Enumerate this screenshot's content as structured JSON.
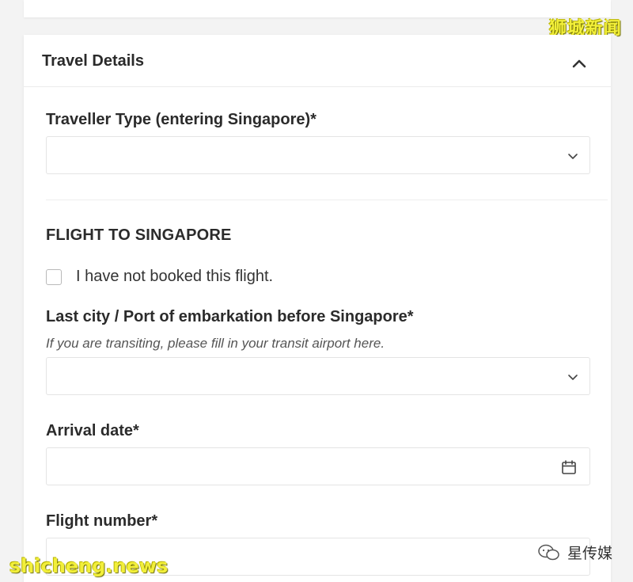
{
  "watermarks": {
    "top_right": "狮城新闻",
    "bottom_left": "shicheng.news",
    "bottom_right": "星传媒"
  },
  "section": {
    "title": "Travel Details",
    "collapse_icon": "chevron-up-icon"
  },
  "traveller_type": {
    "label": "Traveller Type (entering Singapore)*",
    "value": "",
    "icon": "chevron-down-icon"
  },
  "flight": {
    "heading": "FLIGHT TO SINGAPORE",
    "not_booked_label": "I have not booked this flight.",
    "not_booked_checked": false,
    "last_city_label": "Last city / Port of embarkation before Singapore*",
    "last_city_hint": "If you are transiting, please fill in your transit airport here.",
    "last_city_value": "",
    "arrival_date_label": "Arrival date*",
    "arrival_date_value": "",
    "arrival_date_icon": "calendar-icon",
    "flight_number_label": "Flight number*",
    "flight_number_value": ""
  },
  "colors": {
    "background": "#f3f3f3",
    "card": "#ffffff",
    "border": "#e4e4e4",
    "text": "#2b2b2b",
    "watermark": "#f2ef3a"
  }
}
